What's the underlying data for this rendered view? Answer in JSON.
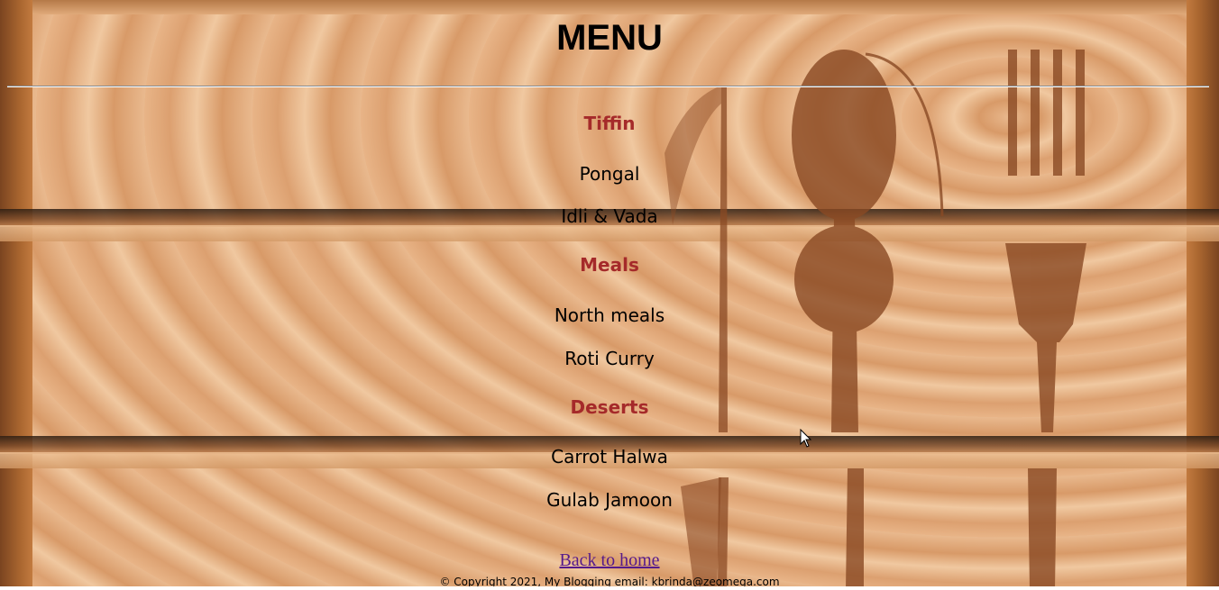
{
  "page": {
    "title": "MENU"
  },
  "menu": {
    "sections": [
      {
        "heading": "Tiffin",
        "items": [
          "Pongal",
          "Idli & Vada"
        ]
      },
      {
        "heading": "Meals",
        "items": [
          "North meals",
          "Roti Curry"
        ]
      },
      {
        "heading": "Deserts",
        "items": [
          "Carrot Halwa",
          "Gulab Jamoon"
        ]
      }
    ]
  },
  "links": {
    "back_home": "Back to home"
  },
  "footer": {
    "text": "© Copyright 2021, My Blogging email: kbrinda@zeomega.com"
  },
  "colors": {
    "heading": "#a52a2a",
    "link": "#551a8b",
    "wood": "#dca070"
  },
  "background": {
    "icons": [
      "spoon-icon",
      "fork-icon",
      "knife-icon"
    ]
  }
}
